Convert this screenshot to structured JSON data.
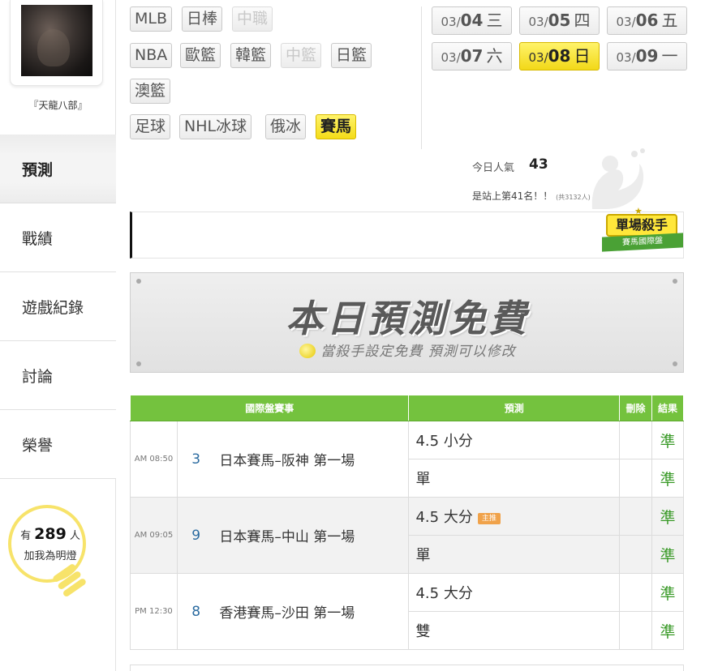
{
  "profile": {
    "username": "『天龍八部』"
  },
  "nav": [
    {
      "label": "預測"
    },
    {
      "label": "戰績"
    },
    {
      "label": "遊戲紀錄"
    },
    {
      "label": "討論"
    },
    {
      "label": "榮譽"
    }
  ],
  "followers": {
    "prefix": "有",
    "count": "289",
    "suffix": "人",
    "line2": "加我為明燈"
  },
  "sports": {
    "row1": [
      "MLB",
      "日棒",
      "中職"
    ],
    "row2": [
      "NBA",
      "歐籃",
      "韓籃",
      "中籃",
      "日籃"
    ],
    "row3": [
      "澳籃"
    ],
    "row4": [
      "足球",
      "NHL冰球",
      "俄冰",
      "賽馬"
    ],
    "selected": "賽馬",
    "disabled": [
      "中職",
      "中籃"
    ]
  },
  "dates": [
    {
      "md": "03/",
      "day": "04",
      "wd": "三"
    },
    {
      "md": "03/",
      "day": "05",
      "wd": "四"
    },
    {
      "md": "03/",
      "day": "06",
      "wd": "五"
    },
    {
      "md": "03/",
      "day": "07",
      "wd": "六"
    },
    {
      "md": "03/",
      "day": "08",
      "wd": "日"
    },
    {
      "md": "03/",
      "day": "09",
      "wd": "一"
    }
  ],
  "popularity": {
    "label": "今日人氣",
    "value": "43",
    "rank": "是站上第41名！！",
    "total": "(共3132人)"
  },
  "killer_badge": {
    "title": "單場殺手",
    "subtitle": "賽馬國際盤"
  },
  "free_banner": {
    "title": "本日預測免費",
    "subtitle": "當殺手設定免費 預測可以修改"
  },
  "table": {
    "headers": {
      "event": "國際盤賽事",
      "prediction": "預測",
      "delete": "刪除",
      "result": "結果"
    },
    "master_tag": "主推",
    "rows": [
      {
        "time": "AM 08:50",
        "num": "3",
        "event": "日本賽馬–阪神 第一場",
        "pred1": "4.5 小分",
        "res1": "準",
        "pred2": "單",
        "res2": "準"
      },
      {
        "time": "AM 09:05",
        "num": "9",
        "event": "日本賽馬–中山 第一場",
        "pred1": "4.5 大分",
        "res1": "準",
        "pred2": "單",
        "res2": "準"
      },
      {
        "time": "PM 12:30",
        "num": "8",
        "event": "香港賽馬–沙田 第一場",
        "pred1": "4.5 大分",
        "res1": "準",
        "pred2": "雙",
        "res2": "準"
      }
    ]
  },
  "colors": {
    "accent_green": "#74c23e",
    "highlight_yellow": "#f4dc18",
    "result_green": "#3a9a28"
  }
}
